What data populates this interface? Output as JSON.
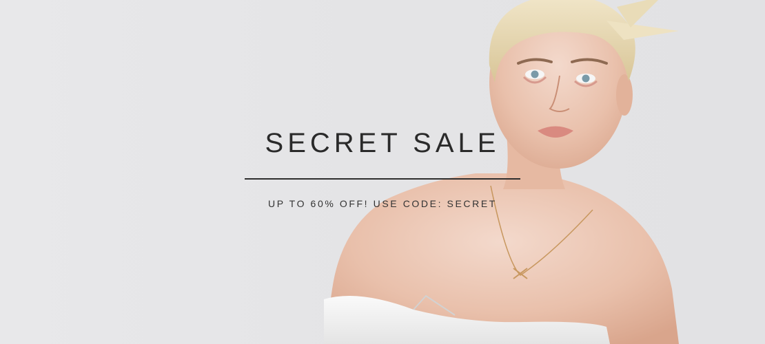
{
  "banner": {
    "headline": "SECRET SALE",
    "subline": "UP TO 60% OFF! USE CODE: SECRET"
  },
  "colors": {
    "background": "#e6e6e8",
    "text": "#2a2a2a",
    "divider": "#2d2d2d"
  }
}
